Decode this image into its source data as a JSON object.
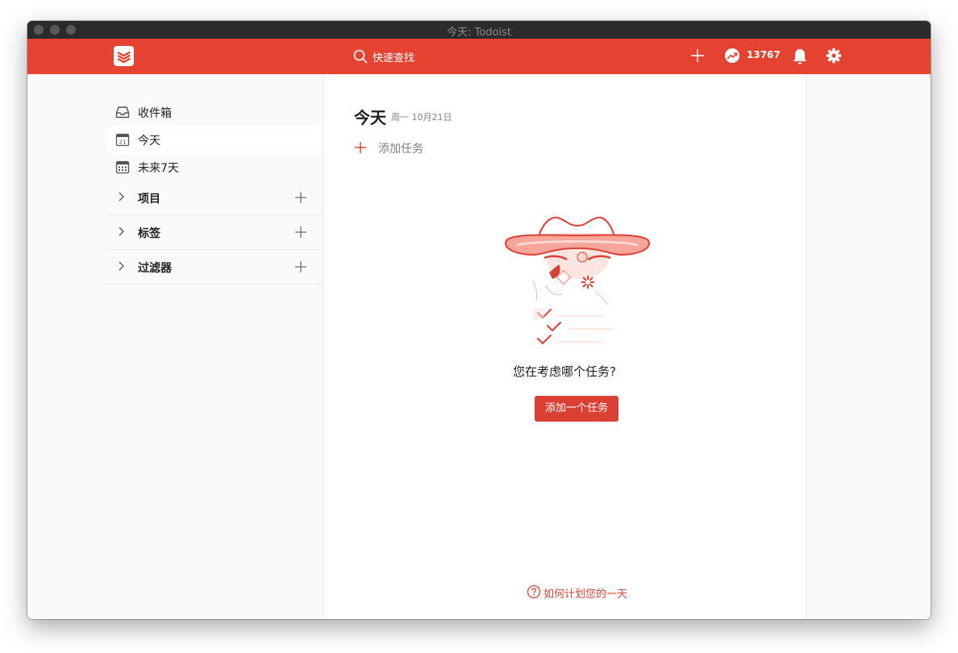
{
  "window": {
    "title": "今天: Todoist"
  },
  "topbar": {
    "search_placeholder": "快速查找",
    "karma_count": "13767"
  },
  "sidebar": {
    "items": [
      {
        "label": "收件箱",
        "icon": "inbox-icon"
      },
      {
        "label": "今天",
        "icon": "calendar-today-icon",
        "day": "21"
      },
      {
        "label": "未来7天",
        "icon": "calendar-week-icon"
      }
    ],
    "sections": [
      {
        "label": "项目"
      },
      {
        "label": "标签"
      },
      {
        "label": "过滤器"
      }
    ]
  },
  "main": {
    "title": "今天",
    "date": "周一 10月21日",
    "add_task_label": "添加任务",
    "empty_state": {
      "question": "您在考虑哪个任务?",
      "button_label": "添加一个任务"
    },
    "help_link": "如何计划您的一天"
  },
  "colors": {
    "brand": "#e44332",
    "accent": "#db4035"
  }
}
